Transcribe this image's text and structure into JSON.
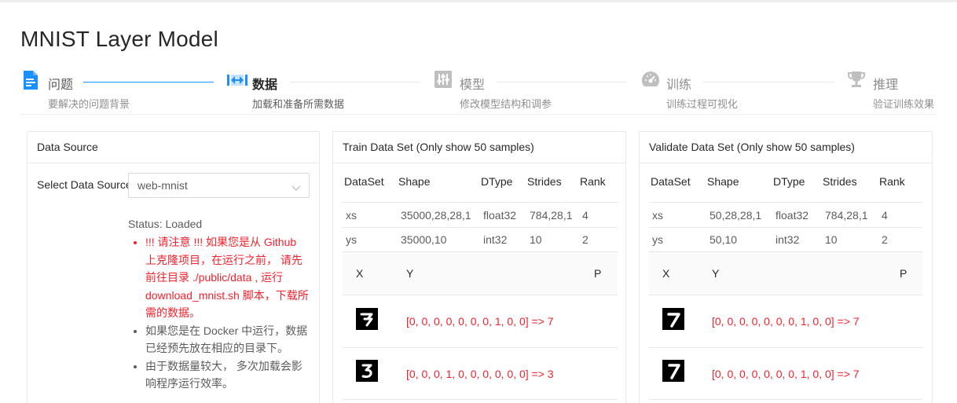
{
  "page": {
    "title": "MNIST Layer Model"
  },
  "colors": {
    "accent": "#1890ff",
    "warning": "#f5222d",
    "border": "#e8e8e8"
  },
  "steps": [
    {
      "icon": "file-text-icon",
      "title": "问题",
      "description": "要解决的问题背景",
      "state": "done"
    },
    {
      "icon": "column-width-icon",
      "title": "数据",
      "description": "加载和准备所需数据",
      "state": "active"
    },
    {
      "icon": "sliders-icon",
      "title": "模型",
      "description": "修改模型结构和调参",
      "state": "wait"
    },
    {
      "icon": "dashboard-icon",
      "title": "训练",
      "description": "训练过程可视化",
      "state": "wait"
    },
    {
      "icon": "trophy-icon",
      "title": "推理",
      "description": "验证训练效果",
      "state": "wait"
    }
  ],
  "data_source": {
    "header": "Data Source",
    "label": "Select Data Source",
    "selected": "web-mnist",
    "status": "Status: Loaded",
    "notes": [
      {
        "text": "!!! 请注意 !!! 如果您是从 Github 上克隆项目，在运行之前， 请先前往目录 ./public/data , 运行 download_mnist.sh 脚本，下载所需的数据。",
        "kind": "warn"
      },
      {
        "text": "如果您是在 Docker 中运行，数据已经预先放在相应的目录下。",
        "kind": "info"
      },
      {
        "text": "由于数据量较大， 多次加载会影响程序运行效率。",
        "kind": "info"
      }
    ]
  },
  "train": {
    "header": "Train Data Set (Only show 50 samples)",
    "columns": [
      "DataSet",
      "Shape",
      "DType",
      "Strides",
      "Rank"
    ],
    "rows": [
      [
        "xs",
        "35000,28,28,1",
        "float32",
        "784,28,1",
        "4"
      ],
      [
        "ys",
        "35000,10",
        "int32",
        "10",
        "2"
      ]
    ],
    "sample_columns": [
      "X",
      "Y",
      "P"
    ],
    "samples": [
      {
        "digit": "7",
        "y": "[0, 0, 0, 0, 0, 0, 0, 1, 0, 0] => 7"
      },
      {
        "digit": "3",
        "y": "[0, 0, 0, 1, 0, 0, 0, 0, 0, 0] => 3"
      }
    ]
  },
  "validate": {
    "header": "Validate Data Set (Only show 50 samples)",
    "columns": [
      "DataSet",
      "Shape",
      "DType",
      "Strides",
      "Rank"
    ],
    "rows": [
      [
        "xs",
        "50,28,28,1",
        "float32",
        "784,28,1",
        "4"
      ],
      [
        "ys",
        "50,10",
        "int32",
        "10",
        "2"
      ]
    ],
    "sample_columns": [
      "X",
      "Y",
      "P"
    ],
    "samples": [
      {
        "digit": "7",
        "y": "[0, 0, 0, 0, 0, 0, 0, 1, 0, 0] => 7"
      },
      {
        "digit": "7",
        "y": "[0, 0, 0, 0, 0, 0, 0, 1, 0, 0] => 7"
      }
    ]
  }
}
